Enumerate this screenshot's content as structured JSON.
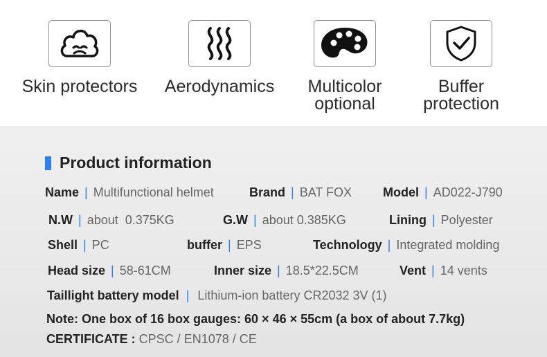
{
  "features": [
    {
      "icon": "cloud-face-icon",
      "label_line1": "Skin protectors",
      "label_line2": ""
    },
    {
      "icon": "airflow-icon",
      "label_line1": "Aerodynamics",
      "label_line2": ""
    },
    {
      "icon": "palette-icon",
      "label_line1": "Multicolor",
      "label_line2": "optional"
    },
    {
      "icon": "shield-check-icon",
      "label_line1": "Buffer",
      "label_line2": "protection"
    }
  ],
  "section_title": "Product information",
  "separator": "|",
  "specs": {
    "name": {
      "key": "Name",
      "value": "Multifunctional helmet"
    },
    "brand": {
      "key": "Brand",
      "value": "BAT FOX"
    },
    "model": {
      "key": "Model",
      "value": "AD022-J790"
    },
    "nw": {
      "key": "N.W",
      "value": "about  0.375KG"
    },
    "gw": {
      "key": "G.W",
      "value": "about 0.385KG"
    },
    "lining": {
      "key": "Lining",
      "value": "Polyester"
    },
    "shell": {
      "key": "Shell",
      "value": "PC"
    },
    "buffer": {
      "key": "buffer",
      "value": "EPS"
    },
    "technology": {
      "key": "Technology",
      "value": "Integrated molding"
    },
    "head_size": {
      "key": "Head size",
      "value": "58-61CM"
    },
    "inner_size": {
      "key": "Inner size",
      "value": "18.5*22.5CM"
    },
    "vent": {
      "key": "Vent",
      "value": "14 vents"
    },
    "battery": {
      "key": "Taillight battery model",
      "value": "Lithium-ion battery CR2032 3V (1)"
    }
  },
  "note": "Note: One box of 16 box gauges: 60 × 46 × 55cm (a box of about 7.7kg)",
  "certificate": {
    "key": "CERTIFICATE :",
    "value": "CPSC / EN1078 / CE"
  },
  "colors": {
    "accent": "#2f7ff0",
    "background": "#eeeeee"
  }
}
